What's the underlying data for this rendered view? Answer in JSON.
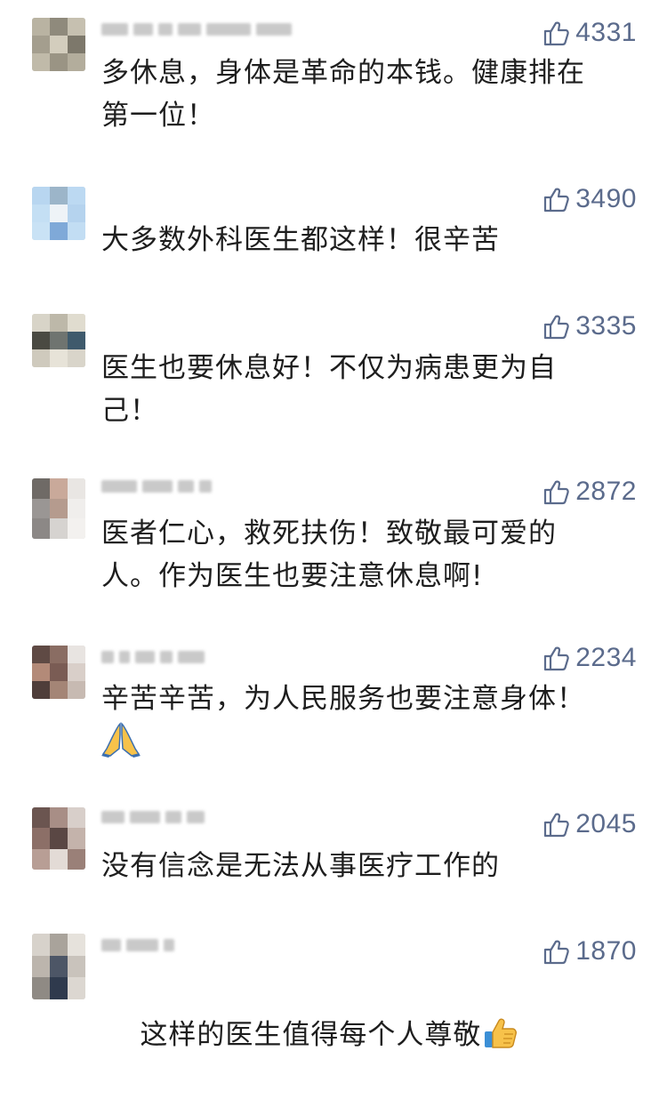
{
  "comments": [
    {
      "like_count": "4331",
      "text": "多休息，身体是革命的本钱。健康排在\n第一位！"
    },
    {
      "like_count": "3490",
      "text": "大多数外科医生都这样！很辛苦"
    },
    {
      "like_count": "3335",
      "text": "医生也要休息好！不仅为病患更为自\n己！"
    },
    {
      "like_count": "2872",
      "text": "医者仁心，救死扶伤！致敬最可爱的\n人。作为医生也要注意休息啊!"
    },
    {
      "like_count": "2234",
      "text": "辛苦辛苦，为人民服务也要注意身体！"
    },
    {
      "like_count": "2045",
      "text": "没有信念是无法从事医疗工作的"
    },
    {
      "like_count": "1870",
      "text": "这样的医生值得每个人尊敬"
    }
  ],
  "icons": {
    "like": "thumbs-up-outline-icon",
    "pray": "folded-hands-emoji-icon",
    "thumbs": "thumbs-up-emoji-icon"
  },
  "colors": {
    "like_text": "#5b6b8c",
    "comment_text": "#1e1e1e"
  }
}
